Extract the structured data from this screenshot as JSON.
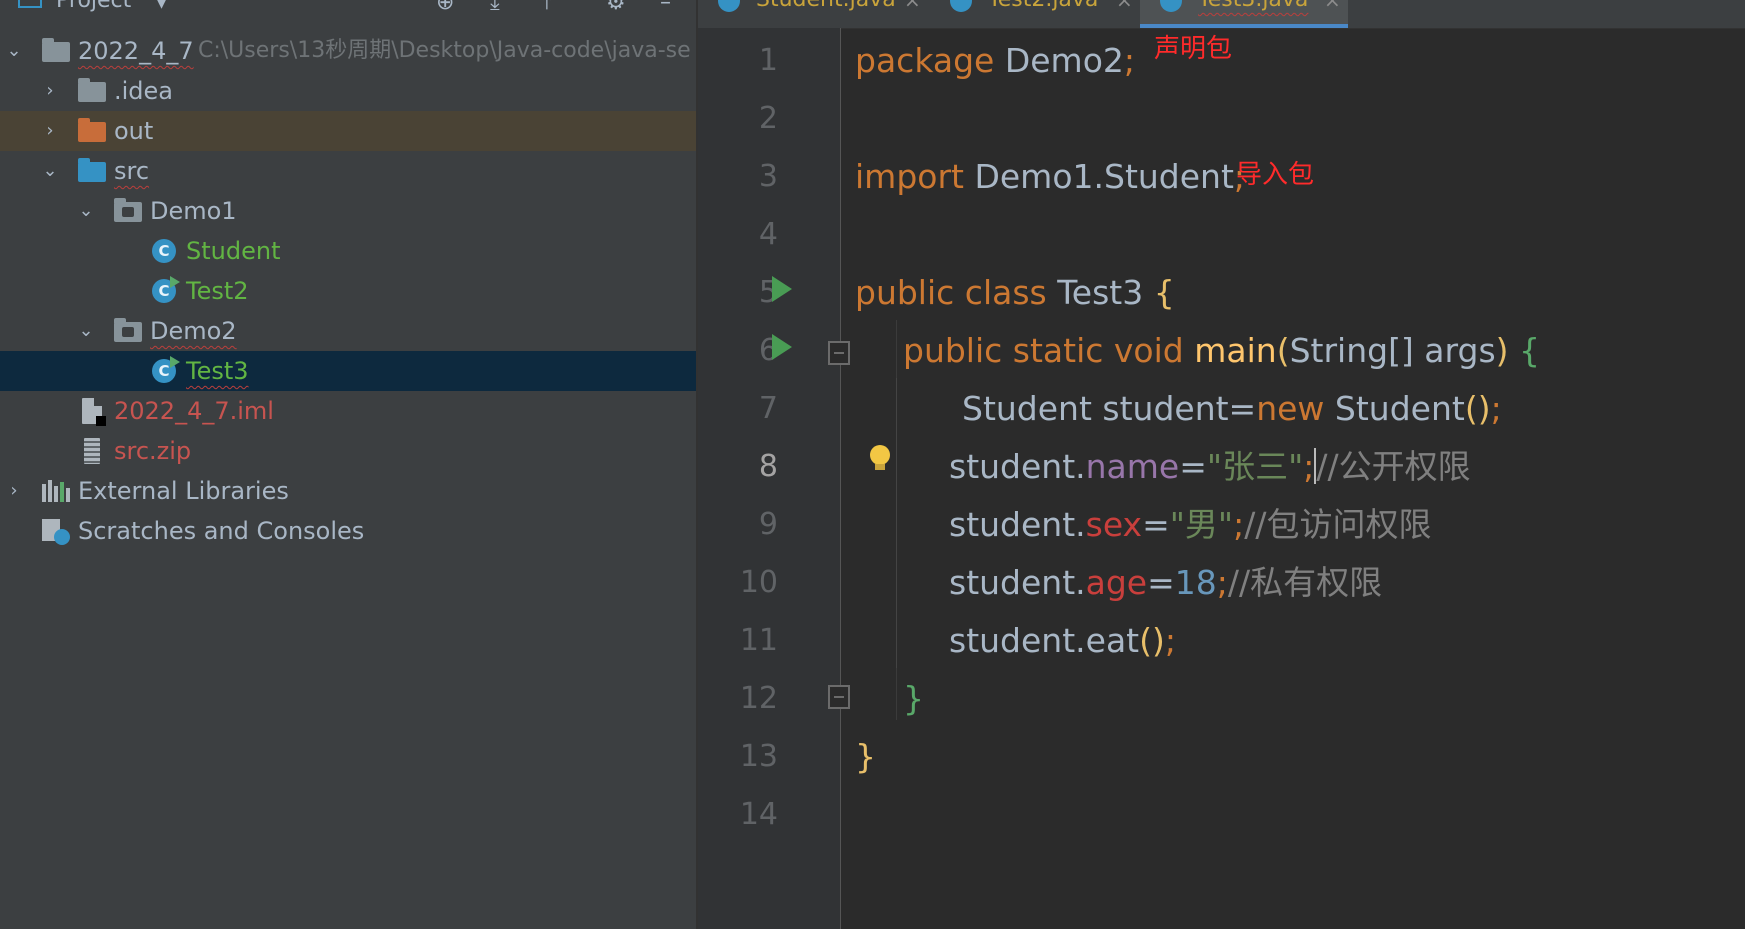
{
  "project_panel": {
    "title": "Project",
    "header_icons": [
      "project-view-icon",
      "dropdown-arrow-icon",
      "locate-icon",
      "expand-all-icon",
      "collapse-all-icon",
      "gear-icon",
      "minimize-icon"
    ],
    "tree": {
      "root_name": "2022_4_7",
      "root_path": "C:\\Users\\13秒周期\\Desktop\\Java-code\\java-se",
      "idea": ".idea",
      "out": "out",
      "src": "src",
      "demo1": "Demo1",
      "student": "Student",
      "test2": "Test2",
      "demo2": "Demo2",
      "test3": "Test3",
      "iml": "2022_4_7.iml",
      "zip": "src.zip",
      "external_libraries": "External Libraries",
      "scratches": "Scratches and Consoles"
    }
  },
  "editor": {
    "tabs": [
      {
        "label": "Student.java"
      },
      {
        "label": "Test2.java"
      },
      {
        "label": "Test3.java",
        "active": true
      }
    ],
    "line_numbers": [
      "1",
      "2",
      "3",
      "4",
      "5",
      "6",
      "7",
      "8",
      "9",
      "10",
      "11",
      "12",
      "13",
      "14"
    ],
    "current_line": "8",
    "code": {
      "l1": {
        "kw": "package",
        "name": "Demo2",
        "semi": ";"
      },
      "l3": {
        "kw": "import",
        "name": "Demo1.Student",
        "semi": ";"
      },
      "l5": {
        "kw1": "public",
        "kw2": "class",
        "name": "Test3",
        "brace": "{"
      },
      "l6": {
        "kw1": "public",
        "kw2": "static",
        "kw3": "void",
        "method": "main",
        "paren_open": "(",
        "params": "String[] args",
        "paren_close": ")",
        "brace": "{"
      },
      "l7": {
        "decl": "Student student",
        "eq": "=",
        "kw": "new",
        "ctor": "Student",
        "parens": "()",
        "semi": ";"
      },
      "l8": {
        "obj": "student.",
        "field": "name",
        "eq": "=",
        "str": "\"张三\"",
        "semi": ";",
        "comment": "//公开权限"
      },
      "l9": {
        "obj": "student.",
        "field": "sex",
        "eq": "=",
        "str": "\"男\"",
        "semi": ";",
        "comment": "//包访问权限"
      },
      "l10": {
        "obj": "student.",
        "field": "age",
        "eq": "=",
        "num": "18",
        "semi": ";",
        "comment": "//私有权限"
      },
      "l11": {
        "obj": "student.eat",
        "parens": "()",
        "semi": ";"
      },
      "l12": {
        "brace": "}"
      },
      "l13": {
        "brace": "}"
      }
    },
    "annotations": {
      "package_note": "声明包",
      "import_note": "导入包"
    }
  },
  "colors": {
    "keyword": "#cc7832",
    "string": "#6a8759",
    "number": "#6897bb",
    "comment": "#808080",
    "field_public": "#9876aa",
    "field_default": "#c93f3c",
    "method": "#ffc66d",
    "paren": "#e8bf6a",
    "brace": "#e8bf6a",
    "annotation": "#ff2b2b",
    "selection": "#0d293e"
  }
}
